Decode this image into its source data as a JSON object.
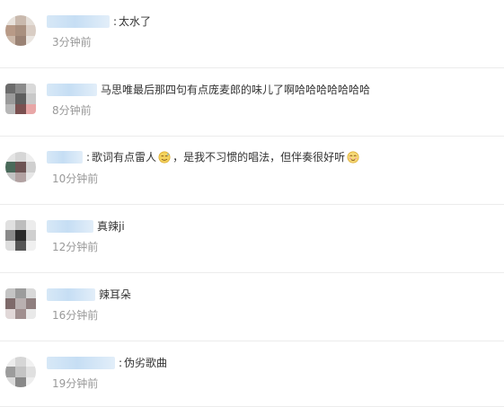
{
  "comments": [
    {
      "text": "太水了",
      "time": "3分钟前"
    },
    {
      "text": "马思唯最后那四句有点庞麦郎的味儿了啊哈哈哈哈哈哈哈",
      "time": "8分钟前"
    },
    {
      "text_a": "歌词有点雷人",
      "text_b": "，是我不习惯的唱法，但伴奏很好听",
      "time": "10分钟前",
      "emoji_a": "sweat-smile-emoji",
      "emoji_b": "blush-emoji"
    },
    {
      "text": "真辣ji",
      "time": "12分钟前"
    },
    {
      "text": "辣耳朵",
      "time": "16分钟前"
    },
    {
      "text": "伪劣歌曲",
      "time": "19分钟前"
    }
  ]
}
